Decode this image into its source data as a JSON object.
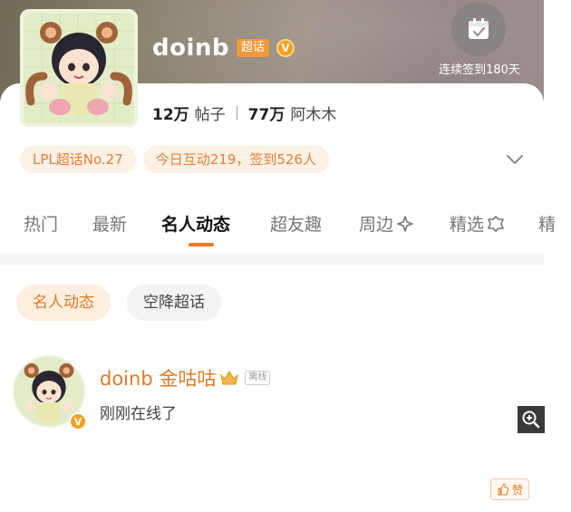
{
  "header": {
    "title": "doinb",
    "super_badge": "超话",
    "verified_badge": "V",
    "checkin": {
      "icon": "calendar-check-icon",
      "text": "连续签到180天"
    },
    "stats": [
      {
        "num": "12万",
        "label": "帖子"
      },
      {
        "num": "77万",
        "label": "阿木木"
      }
    ],
    "tags": [
      "LPL超话No.27",
      "今日互动219，签到526人"
    ],
    "expand_icon": "chevron-down-icon"
  },
  "tabs": [
    {
      "label": "热门"
    },
    {
      "label": "最新"
    },
    {
      "label": "名人动态"
    },
    {
      "label": "超友趣"
    },
    {
      "label": "周边",
      "icon": "sparkle-icon"
    },
    {
      "label": "精选",
      "icon": "badge-icon"
    },
    {
      "label": "精"
    }
  ],
  "chips": [
    "名人动态",
    "空降超话"
  ],
  "post": {
    "author": "doinb 金咕咕",
    "crown_icon": "crown-icon",
    "mini_badge": "离线",
    "status": "刚刚在线了",
    "verified_badge": "V"
  },
  "actions": {
    "zoom_icon": "zoom-in-icon",
    "like_label": "赞",
    "like_icon": "thumbs-up-icon"
  },
  "colors": {
    "accent": "#f07a22",
    "tag_text": "#e0823a",
    "tag_bg": "#fdf0e4"
  }
}
